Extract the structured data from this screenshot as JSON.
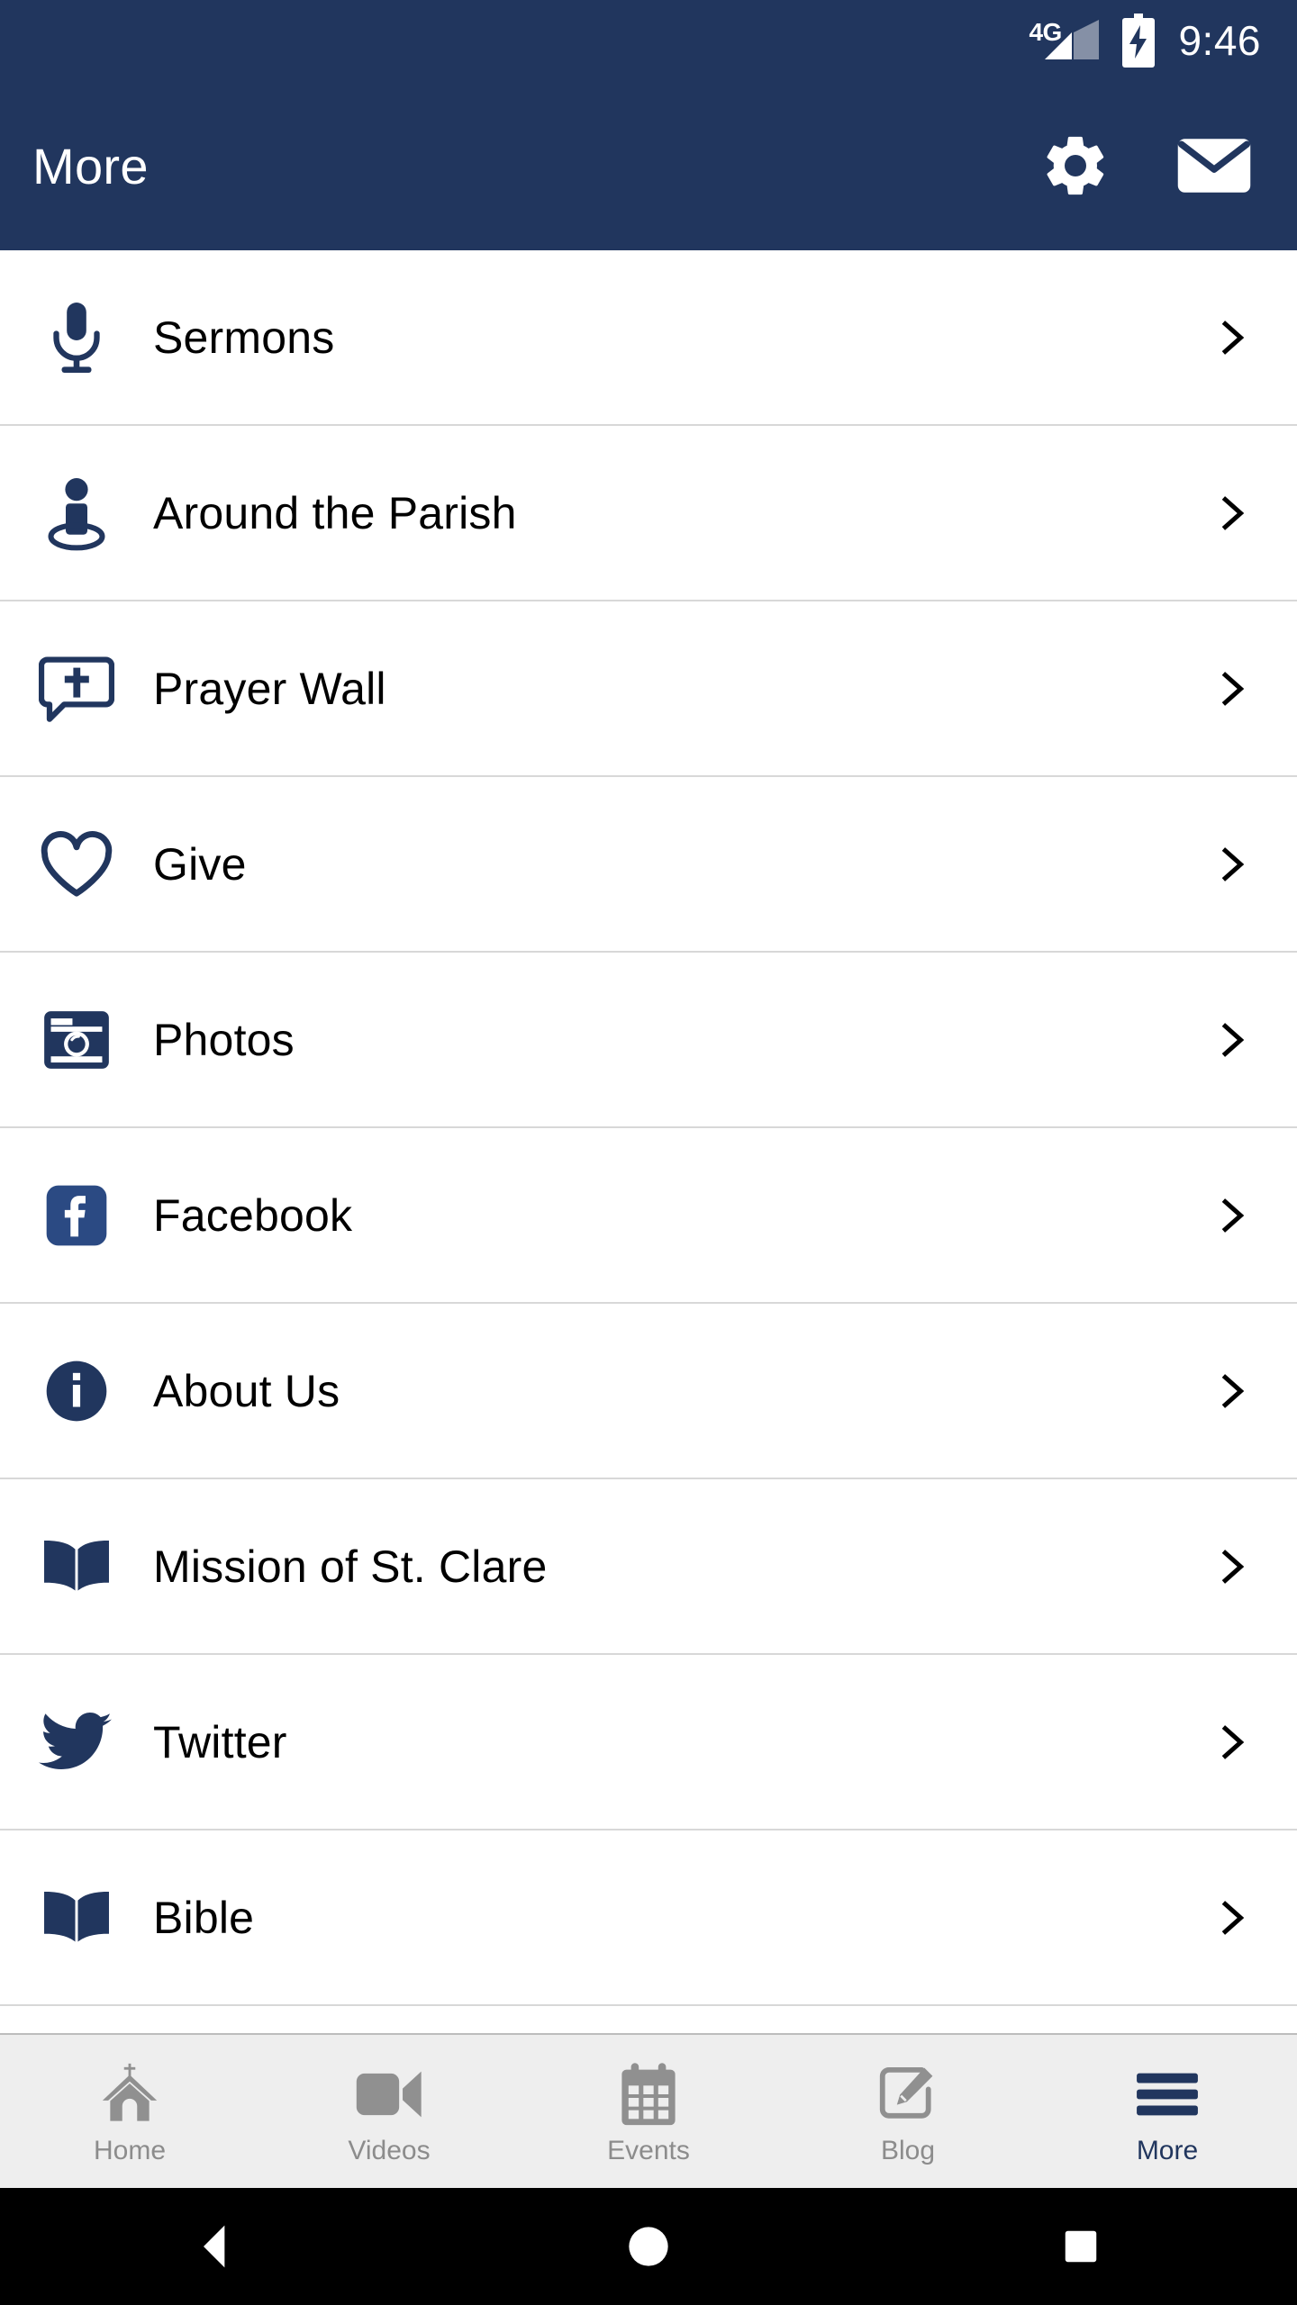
{
  "status_bar": {
    "network_label": "4G",
    "time": "9:46",
    "battery_icon": "battery-charging-icon",
    "signal_icon": "signal-bars-icon"
  },
  "app_bar": {
    "title": "More",
    "actions": [
      {
        "name": "settings-button",
        "icon": "gear-icon"
      },
      {
        "name": "mail-button",
        "icon": "envelope-icon"
      }
    ]
  },
  "colors": {
    "brand_navy": "#21365e",
    "divider": "#d8d8d8",
    "tab_inactive": "#8c8c8c",
    "tab_bar_bg": "#eeeeee",
    "facebook_blue": "#2b4a83"
  },
  "list": {
    "items": [
      {
        "label": "Sermons",
        "icon": "microphone-icon",
        "chevron": "chevron-right-icon"
      },
      {
        "label": "Around the Parish",
        "icon": "person-pin-icon",
        "chevron": "chevron-right-icon"
      },
      {
        "label": "Prayer Wall",
        "icon": "prayer-bubble-icon",
        "chevron": "chevron-right-icon"
      },
      {
        "label": "Give",
        "icon": "heart-outline-icon",
        "chevron": "chevron-right-icon"
      },
      {
        "label": "Photos",
        "icon": "camera-icon",
        "chevron": "chevron-right-icon"
      },
      {
        "label": "Facebook",
        "icon": "facebook-icon",
        "chevron": "chevron-right-icon"
      },
      {
        "label": "About Us",
        "icon": "info-circle-icon",
        "chevron": "chevron-right-icon"
      },
      {
        "label": "Mission of St. Clare",
        "icon": "open-book-icon",
        "chevron": "chevron-right-icon"
      },
      {
        "label": "Twitter",
        "icon": "twitter-bird-icon",
        "chevron": "chevron-right-icon"
      },
      {
        "label": "Bible",
        "icon": "open-book-icon",
        "chevron": "chevron-right-icon"
      }
    ]
  },
  "tab_bar": {
    "tabs": [
      {
        "label": "Home",
        "icon": "church-icon",
        "active": false
      },
      {
        "label": "Videos",
        "icon": "video-camera-icon",
        "active": false
      },
      {
        "label": "Events",
        "icon": "calendar-icon",
        "active": false
      },
      {
        "label": "Blog",
        "icon": "edit-square-icon",
        "active": false
      },
      {
        "label": "More",
        "icon": "hamburger-icon",
        "active": true
      }
    ]
  },
  "android_nav": {
    "buttons": [
      {
        "name": "back-button",
        "icon": "triangle-back-icon"
      },
      {
        "name": "home-button",
        "icon": "circle-home-icon"
      },
      {
        "name": "recents-button",
        "icon": "square-recents-icon"
      }
    ]
  }
}
